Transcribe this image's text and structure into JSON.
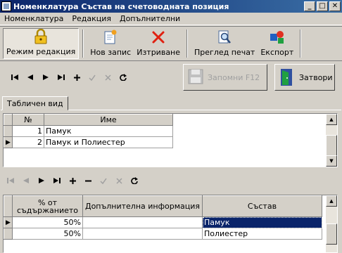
{
  "window": {
    "title": "Номенклатура Състав на счетоводната позиция"
  },
  "menu": [
    "Номенклатура",
    "Редакция",
    "Допълнителни"
  ],
  "toolbar": {
    "edit_mode": "Режим редакция",
    "new_record": "Нов запис",
    "delete": "Изтриване",
    "print_preview": "Преглед печат",
    "export": "Експорт"
  },
  "actions": {
    "save": "Запомни  F12",
    "close": "Затвори"
  },
  "tab": {
    "label": "Табличен вид"
  },
  "top_grid": {
    "headers": [
      "№",
      "Име"
    ],
    "rows": [
      {
        "no": "1",
        "name": "Памук"
      },
      {
        "no": "2",
        "name": "Памук и Полиестер"
      }
    ]
  },
  "bottom_grid": {
    "headers": [
      "% от съдържанието",
      "Допълнителна информация",
      "Състав"
    ],
    "rows": [
      {
        "pct": "50%",
        "info": "",
        "comp": "Памук"
      },
      {
        "pct": "50%",
        "info": "",
        "comp": "Полиестер"
      }
    ]
  }
}
